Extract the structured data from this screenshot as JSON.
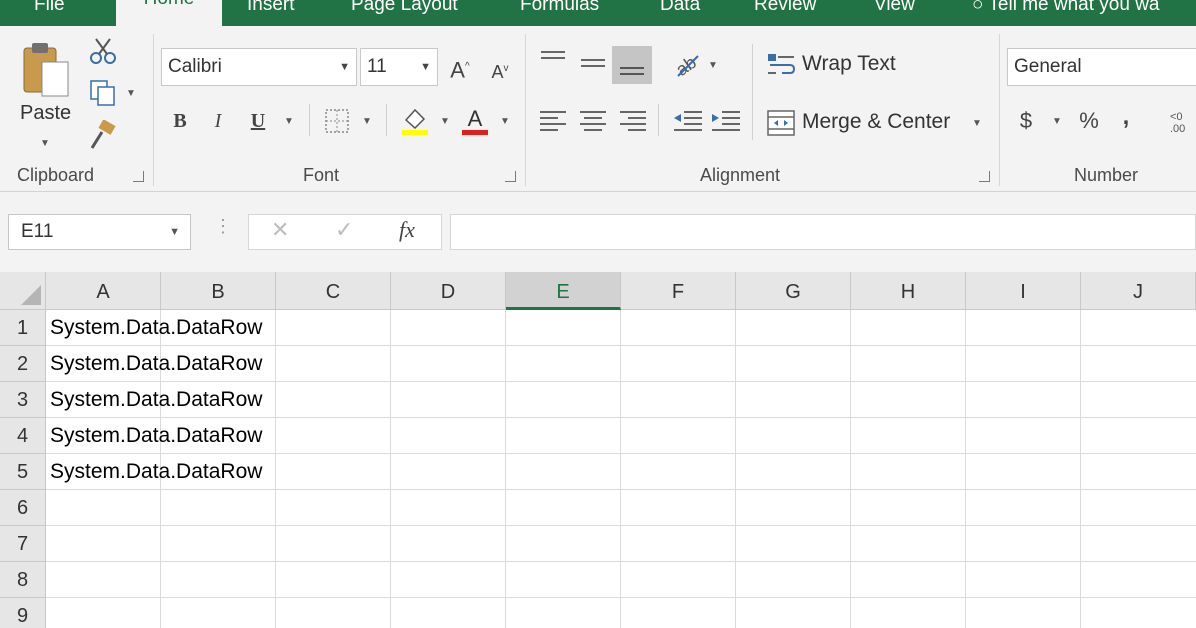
{
  "tabs": [
    "File",
    "Home",
    "Insert",
    "Page Layout",
    "Formulas",
    "Data",
    "Review",
    "View",
    "Tell me what you wa"
  ],
  "active_tab": "Home",
  "ribbon": {
    "clipboard": {
      "paste_label": "Paste",
      "group_label": "Clipboard"
    },
    "font": {
      "font_name": "Calibri",
      "font_size": "11",
      "bold": "B",
      "italic": "I",
      "underline": "U",
      "group_label": "Font"
    },
    "alignment": {
      "wrap_text": "Wrap Text",
      "merge_center": "Merge & Center",
      "group_label": "Alignment"
    },
    "number": {
      "format": "General",
      "currency": "$",
      "percent": "%",
      "comma": ",",
      "group_label": "Number"
    }
  },
  "formula_bar": {
    "name_box": "E11",
    "fx_label": "fx",
    "formula": ""
  },
  "sheet": {
    "columns": [
      "A",
      "B",
      "C",
      "D",
      "E",
      "F",
      "G",
      "H",
      "I",
      "J"
    ],
    "selected_column": "E",
    "rows": [
      "1",
      "2",
      "3",
      "4",
      "5",
      "6",
      "7",
      "8",
      "9"
    ],
    "cells": [
      "System.Data.DataRow",
      "System.Data.DataRow",
      "System.Data.DataRow",
      "System.Data.DataRow",
      "System.Data.DataRow"
    ]
  },
  "colors": {
    "accent": "#217346",
    "ribbon_bg": "#f3f3f3",
    "header_bg": "#e6e6e6"
  }
}
